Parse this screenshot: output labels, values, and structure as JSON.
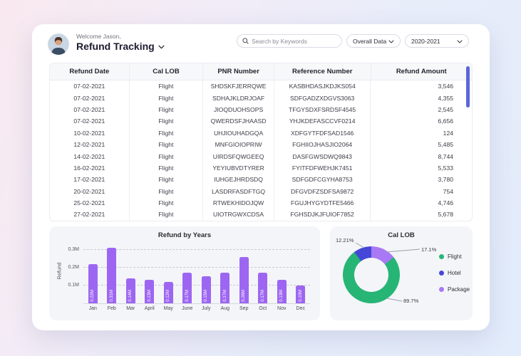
{
  "header": {
    "welcome": "Welcome Jason,",
    "title": "Refund Tracking",
    "search": {
      "placeholder": "Search by Keywords"
    },
    "filters": [
      {
        "label": "Overall Data"
      },
      {
        "label": "2020-2021"
      }
    ]
  },
  "table": {
    "columns": [
      "Refund Date",
      "Cal LOB",
      "PNR Number",
      "Reference Number",
      "Refund Amount"
    ],
    "rows": [
      [
        "07-02-2021",
        "Flight",
        "SHDSKFJERRQWE",
        "KASBHDASJKDJKS054",
        "3,546"
      ],
      [
        "07-02-2021",
        "Flight",
        "SDHAJKLDRJOAF",
        "SDFGADZXDGVS3063",
        "4,355"
      ],
      [
        "07-02-2021",
        "Flight",
        "JIOQDUOHSOPS",
        "TFGYSDXFSRDSF4545",
        "2,545"
      ],
      [
        "07-02-2021",
        "Flight",
        "QWERDSFJHAASD",
        "YHJKDEFASCCVF0214",
        "6,656"
      ],
      [
        "10-02-2021",
        "Flight",
        "UHJIOUHADGQA",
        "XDFGYTFDFSAD1546",
        "124"
      ],
      [
        "12-02-2021",
        "Flight",
        "MNFGIOIOPRIW",
        "FGHIIOJHASJIO2064",
        "5,485"
      ],
      [
        "14-02-2021",
        "Flight",
        "UIRDSFQWGEEQ",
        "DASFGWSDWQ9843",
        "8,744"
      ],
      [
        "16-02-2021",
        "Flight",
        "YEYIUBVDTYRER",
        "FYITFDFWEHJK7451",
        "5,533"
      ],
      [
        "17-02-2021",
        "Flight",
        "IUHGEJHRDSDQ",
        "SDFGDFCGYHA8753",
        "3,780"
      ],
      [
        "20-02-2021",
        "Flight",
        "LASDRFASDFTGQ",
        "DFGVDFZSDFSA9872",
        "754"
      ],
      [
        "25-02-2021",
        "Flight",
        "RTWEKHIDOJQW",
        "FGUJHYGYDTFE5466",
        "4,746"
      ],
      [
        "27-02-2021",
        "Flight",
        "UIOTRGWXCDSA",
        "FGHSDJKJFUIOF7852",
        "5,678"
      ]
    ]
  },
  "chart_data": [
    {
      "type": "bar",
      "title": "Refund by Years",
      "xlabel": "",
      "ylabel": "Refund",
      "categories": [
        "Jan",
        "Feb",
        "Mar",
        "April",
        "May",
        "June",
        "July",
        "Aug",
        "Sep",
        "Oct",
        "Nov",
        "Dec"
      ],
      "values": [
        0.22,
        0.31,
        0.14,
        0.13,
        0.12,
        0.17,
        0.15,
        0.17,
        0.26,
        0.17,
        0.13,
        0.1
      ],
      "unit": "M",
      "bar_labels": [
        "0.22M",
        "0.31M",
        "0.14M",
        "0.13M",
        "0.12M",
        "0.17M",
        "0.15M",
        "0.17M",
        "0.26M",
        "0.17M",
        "0.13M",
        "0.10M"
      ],
      "yticks": [
        {
          "label": "0.3M",
          "value": 0.3
        },
        {
          "label": "0.2M",
          "value": 0.2
        },
        {
          "label": "0.1M",
          "value": 0.1
        }
      ],
      "ylim": [
        0,
        0.35
      ],
      "bar_color": "#9d66f2",
      "grid": "dashed-horizontal",
      "legend_position": "none"
    },
    {
      "type": "pie",
      "donut": true,
      "title": "Cal LOB",
      "labels": [
        "Flight",
        "Hotel",
        "Package"
      ],
      "values": [
        89.7,
        12.21,
        17.1
      ],
      "shown_labels": [
        "12.21%",
        "17.1%",
        "89.7%"
      ],
      "colors": [
        "#27b576",
        "#4547d8",
        "#a978f5"
      ],
      "legend_position": "right"
    }
  ],
  "theme": {
    "accent_purple": "#9d66f2",
    "scrollbar": "#5b67d8",
    "pie_green": "#27b576",
    "pie_blue": "#4547d8",
    "pie_purple": "#a978f5"
  }
}
